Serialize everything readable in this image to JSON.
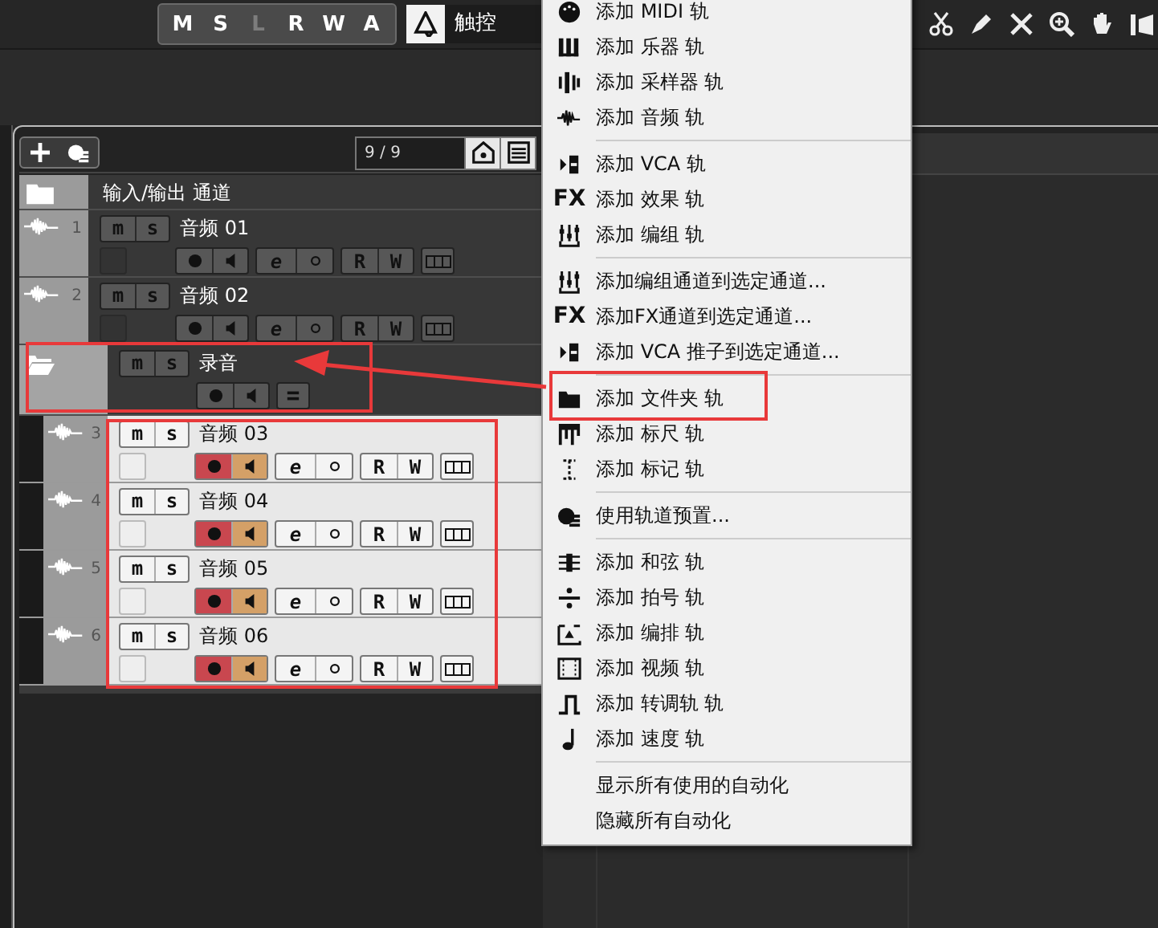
{
  "toolbar": {
    "automation_buttons": [
      {
        "label": "M",
        "disabled": false
      },
      {
        "label": "S",
        "disabled": false
      },
      {
        "label": "L",
        "disabled": true
      },
      {
        "label": "R",
        "disabled": false
      },
      {
        "label": "W",
        "disabled": false
      },
      {
        "label": "A",
        "disabled": false
      }
    ],
    "automation_mode": "触控"
  },
  "track_list": {
    "track_count": "9 / 9",
    "tracks": [
      {
        "kind": "folder",
        "name": "输入/输出 通道",
        "selected": false,
        "expanded": false
      },
      {
        "kind": "audio",
        "number": "1",
        "name": "音频 01",
        "selected": false,
        "record": false,
        "monitor": false,
        "mute_label": "m",
        "solo_label": "s",
        "edit_label": "e",
        "read_label": "R",
        "write_label": "W"
      },
      {
        "kind": "audio",
        "number": "2",
        "name": "音频 02",
        "selected": false,
        "record": false,
        "monitor": false,
        "mute_label": "m",
        "solo_label": "s",
        "edit_label": "e",
        "read_label": "R",
        "write_label": "W"
      },
      {
        "kind": "folder",
        "name": "录音",
        "selected": false,
        "expanded": true,
        "record": false,
        "monitor": false,
        "mute_label": "m",
        "solo_label": "s",
        "children": [
          {
            "kind": "audio",
            "number": "3",
            "name": "音频 03",
            "selected": true,
            "record": true,
            "monitor": true,
            "mute_label": "m",
            "solo_label": "s",
            "edit_label": "e",
            "read_label": "R",
            "write_label": "W"
          },
          {
            "kind": "audio",
            "number": "4",
            "name": "音频 04",
            "selected": true,
            "record": true,
            "monitor": true,
            "mute_label": "m",
            "solo_label": "s",
            "edit_label": "e",
            "read_label": "R",
            "write_label": "W"
          },
          {
            "kind": "audio",
            "number": "5",
            "name": "音频 05",
            "selected": true,
            "record": true,
            "monitor": true,
            "mute_label": "m",
            "solo_label": "s",
            "edit_label": "e",
            "read_label": "R",
            "write_label": "W"
          },
          {
            "kind": "audio",
            "number": "6",
            "name": "音频 06",
            "selected": true,
            "record": true,
            "monitor": true,
            "mute_label": "m",
            "solo_label": "s",
            "edit_label": "e",
            "read_label": "R",
            "write_label": "W"
          }
        ]
      }
    ]
  },
  "context_menu": {
    "groups": [
      {
        "items": [
          {
            "label": "添加 MIDI 轨"
          },
          {
            "label": "添加 乐器 轨"
          },
          {
            "label": "添加 采样器 轨"
          },
          {
            "label": "添加 音频 轨"
          }
        ]
      },
      {
        "items": [
          {
            "label": "添加 VCA 轨"
          },
          {
            "label": "添加 效果 轨",
            "icon_text": "FX"
          },
          {
            "label": "添加 编组 轨"
          }
        ]
      },
      {
        "items": [
          {
            "label": "添加编组通道到选定通道..."
          },
          {
            "label": "添加FX通道到选定通道...",
            "icon_text": "FX"
          },
          {
            "label": "添加 VCA 推子到选定通道..."
          }
        ]
      },
      {
        "items": [
          {
            "label": "添加 文件夹 轨"
          },
          {
            "label": "添加 标尺 轨"
          },
          {
            "label": "添加 标记 轨"
          }
        ]
      },
      {
        "items": [
          {
            "label": "使用轨道预置..."
          }
        ]
      },
      {
        "items": [
          {
            "label": "添加 和弦 轨"
          },
          {
            "label": "添加 拍号 轨"
          },
          {
            "label": "添加 编排 轨"
          },
          {
            "label": "添加 视频 轨"
          },
          {
            "label": "添加 转调轨 轨"
          },
          {
            "label": "添加 速度 轨"
          }
        ]
      },
      {
        "items": [
          {
            "label": "显示所有使用的自动化"
          },
          {
            "label": "隐藏所有自动化"
          }
        ]
      }
    ]
  }
}
